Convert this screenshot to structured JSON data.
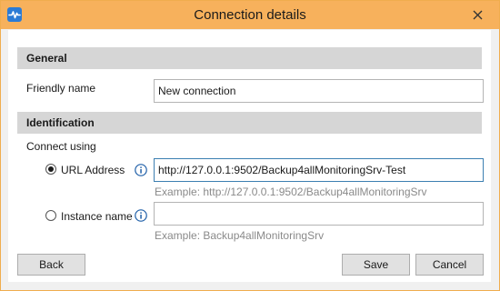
{
  "window": {
    "title": "Connection details",
    "app_icon": "pulse-icon",
    "close_icon": "close-icon",
    "accent_color": "#f7b15c"
  },
  "general": {
    "section_title": "General",
    "friendly_name_label": "Friendly name",
    "friendly_name_value": "New connection"
  },
  "identification": {
    "section_title": "Identification",
    "connect_using_label": "Connect using",
    "url_option": {
      "label": "URL Address",
      "selected": true,
      "value": "http://127.0.0.1:9502/Backup4allMonitoringSrv-Test",
      "example": "Example: http://127.0.0.1:9502/Backup4allMonitoringSrv",
      "info_icon": "info-icon"
    },
    "instance_option": {
      "label": "Instance name",
      "selected": false,
      "value": "",
      "example": "Example: Backup4allMonitoringSrv",
      "info_icon": "info-icon"
    }
  },
  "buttons": {
    "back": "Back",
    "save": "Save",
    "cancel": "Cancel"
  }
}
